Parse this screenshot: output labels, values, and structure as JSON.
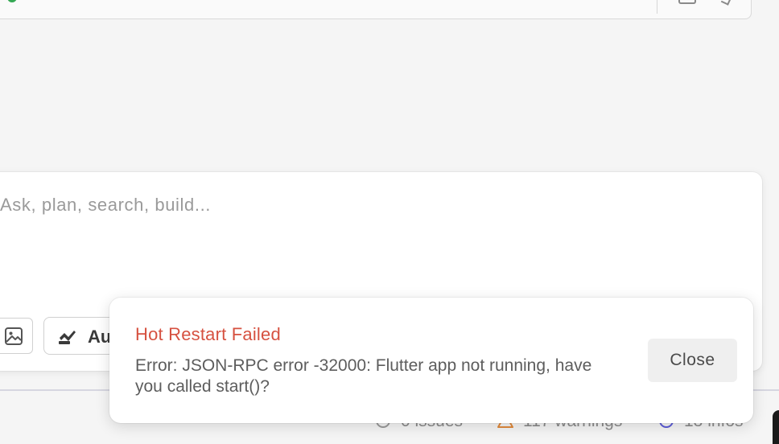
{
  "top_bar": {
    "status_color": "#34a853"
  },
  "composer": {
    "placeholder": "Ask, plan, search, build...",
    "image_button_icon": "image-icon",
    "mode_button": {
      "icon": "infinity-agent-icon",
      "label": "Au"
    }
  },
  "status_bar": {
    "issues": "0 issues",
    "warnings": "117 warnings",
    "infos": "13 infos"
  },
  "toast": {
    "title": "Hot Restart Failed",
    "title_color": "#d65140",
    "message": "Error: JSON-RPC error -32000: Flutter app not running, have you called start()?",
    "close_label": "Close"
  }
}
